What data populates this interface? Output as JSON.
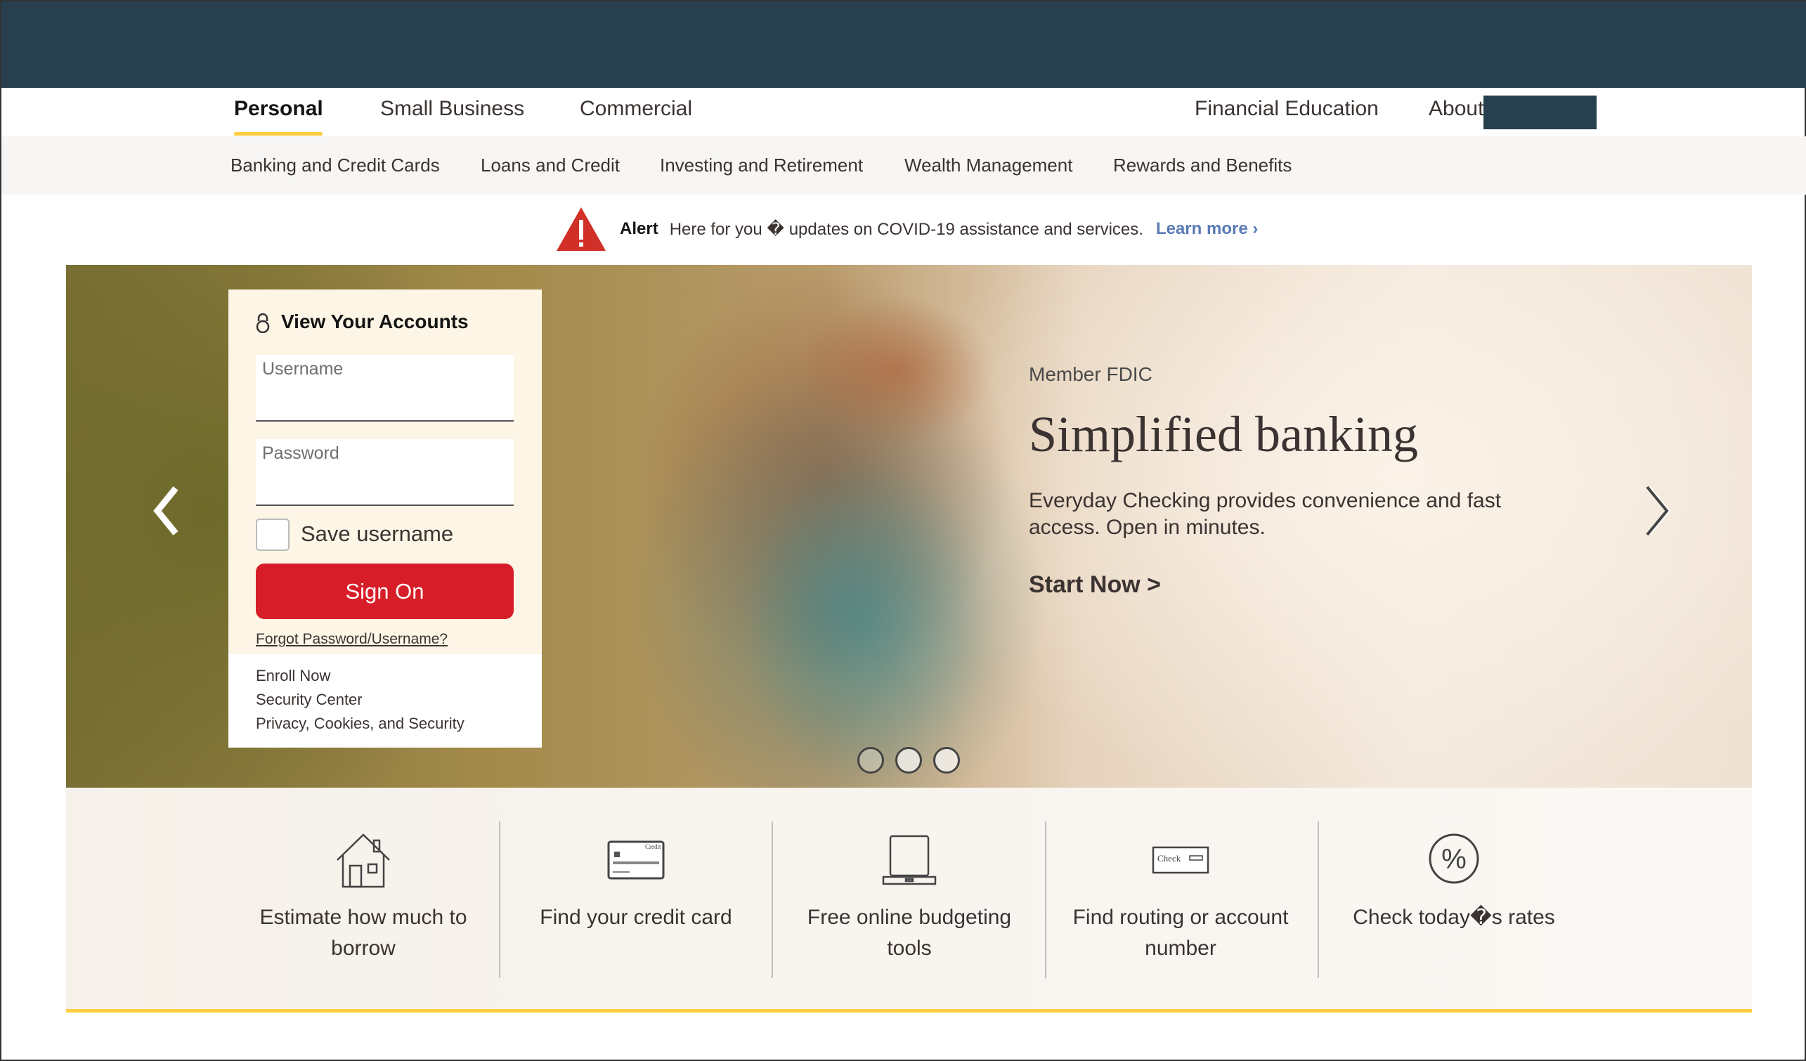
{
  "topnav": {
    "items": [
      {
        "label": "Personal",
        "active": true
      },
      {
        "label": "Small Business"
      },
      {
        "label": "Commercial"
      }
    ],
    "right": [
      {
        "label": "Financial Education"
      },
      {
        "label": "About"
      }
    ]
  },
  "subnav": {
    "items": [
      {
        "label": "Banking and Credit Cards"
      },
      {
        "label": "Loans and Credit"
      },
      {
        "label": "Investing and Retirement"
      },
      {
        "label": "Wealth Management"
      },
      {
        "label": "Rewards and Benefits"
      }
    ]
  },
  "alert": {
    "icon": "warning-triangle-icon",
    "label": "Alert",
    "message": "Here for you � updates on COVID-19 assistance and services.",
    "link": "Learn more",
    "link_arrow": "›",
    "colors": {
      "icon": "#d03027",
      "link": "#5a7bb5"
    }
  },
  "login": {
    "title": "View Your Accounts",
    "username_placeholder": "Username",
    "password_placeholder": "Password",
    "save_username_label": "Save username",
    "save_username_checked": false,
    "sign_on_label": "Sign On",
    "forgot_link": "Forgot Password/Username?",
    "links": [
      "Enroll Now",
      "Security Center",
      "Privacy, Cookies, and Security"
    ],
    "colors": {
      "button": "#d71e28",
      "panel": "#fdf5e6"
    }
  },
  "hero": {
    "eyebrow": "Member FDIC",
    "headline": "Simplified banking",
    "description": "Everyday Checking provides convenience and fast access. Open in minutes.",
    "cta": "Start Now >",
    "slide_count": 3
  },
  "quick_links": [
    {
      "icon": "house-icon",
      "label": "Estimate how much to borrow"
    },
    {
      "icon": "credit-card-icon",
      "label": "Find your credit card",
      "icon_text": "Credit"
    },
    {
      "icon": "laptop-icon",
      "label": "Free online budgeting tools"
    },
    {
      "icon": "check-icon",
      "label": "Find routing or account number",
      "icon_text": "Check"
    },
    {
      "icon": "percent-icon",
      "label": "Check today�s rates",
      "icon_text": "%"
    }
  ],
  "colors": {
    "topbar": "#273f4e",
    "accent": "#ffcd41",
    "subnav_bg": "#f7f6f4"
  }
}
